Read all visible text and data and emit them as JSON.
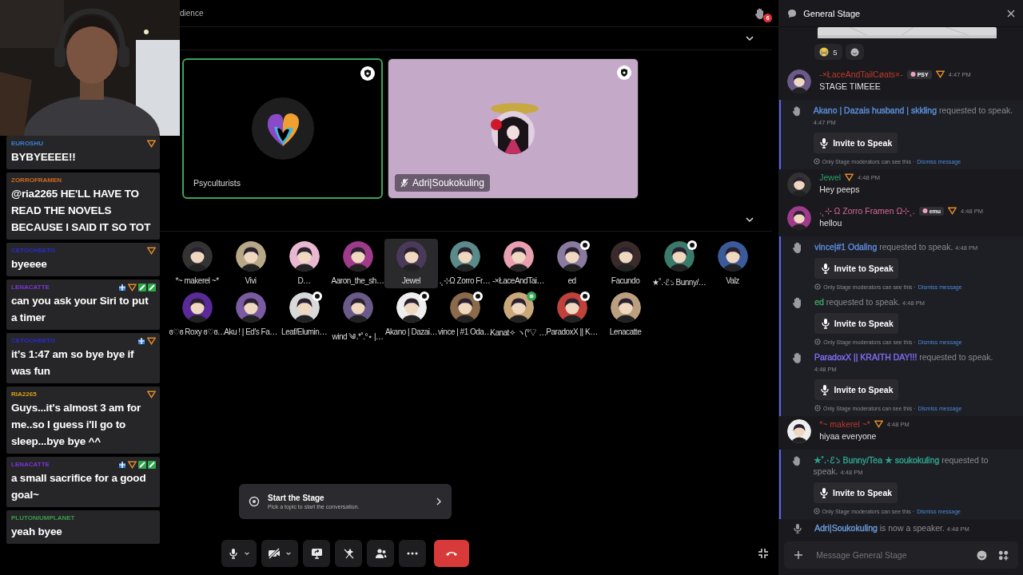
{
  "stage": {
    "topic": "dience",
    "raised_hands": "6",
    "speakers": [
      {
        "name": "Psyculturists",
        "speaking": true,
        "muted": false,
        "color": "#000000",
        "kind": "logo"
      },
      {
        "name": "Adri|Soukokuling",
        "speaking": false,
        "muted": true,
        "color": "#c4aac8",
        "kind": "picture"
      }
    ],
    "audience": [
      {
        "name": "*~ makerel ~*",
        "selected": false
      },
      {
        "name": "Vivi",
        "selected": false
      },
      {
        "name": "D…",
        "selected": false
      },
      {
        "name": "Aaron_the_sh…",
        "selected": false
      },
      {
        "name": "Jewel",
        "selected": true
      },
      {
        "name": ".˛⊹Ω Zorro Fr…",
        "selected": false
      },
      {
        "name": "-×ŁaceAndTai…",
        "selected": false
      },
      {
        "name": "ed",
        "selected": false,
        "badge": {
          "kind": "moderator"
        }
      },
      {
        "name": "Facundo",
        "selected": false
      },
      {
        "name": "★˚.·ℰ১ Bunny/…",
        "selected": false,
        "badge": {
          "kind": "moderator"
        }
      },
      {
        "name": "Valz",
        "selected": false
      },
      {
        "name": "ɞ♡ɞ Roxy ɞ♡ɞ…",
        "selected": false
      },
      {
        "name": "Aku ! | Ed's Fa…",
        "selected": false
      },
      {
        "name": "Leaf/Elumin…",
        "selected": false,
        "badge": {
          "kind": "moderator"
        }
      },
      {
        "name": "wind ༄.*˚.°⋆ |…",
        "selected": false
      },
      {
        "name": "Akano | Dazai…",
        "selected": false,
        "badge": {
          "kind": "moderator"
        }
      },
      {
        "name": "vince | #1 Oda…",
        "selected": false,
        "badge": {
          "kind": "moderator"
        }
      },
      {
        "name": "Kanat✧ ヽ(°▽ …",
        "selected": false,
        "badge": {
          "kind": "boost"
        }
      },
      {
        "name": "ParadoxX || K…",
        "selected": false,
        "badge": {
          "kind": "moderator"
        }
      },
      {
        "name": "Lenacatte",
        "selected": false
      }
    ],
    "start_card": {
      "title": "Start the Stage",
      "subtitle": "Pick a topic to start the conversation."
    },
    "controls": [
      {
        "kind": "mic",
        "caret": true
      },
      {
        "kind": "camera-off",
        "caret": true
      },
      {
        "kind": "share"
      },
      {
        "kind": "effects-off"
      },
      {
        "kind": "people"
      },
      {
        "kind": "more"
      },
      {
        "kind": "leave"
      }
    ]
  },
  "chat_overlay": [
    {
      "user": "EUROSHU",
      "color": "#3b7fd4",
      "badges": [
        {
          "kind": "triangle"
        }
      ],
      "text": "BYBYEEEE!!"
    },
    {
      "user": "ZORROFRAMEN",
      "color": "#d2691e",
      "text": "@ria2265 HE'LL HAVE TO READ THE NOVELS BECAUSE I SAID IT SO TOT"
    },
    {
      "user": "CETOCHEETO",
      "color": "#2a2ad0",
      "badges": [
        {
          "kind": "triangle"
        }
      ],
      "text": "byeeee"
    },
    {
      "user": "LENACATTE",
      "color": "#7a35d6",
      "badges": [
        {
          "kind": "gift"
        },
        {
          "kind": "triangle"
        },
        {
          "kind": "sword"
        },
        {
          "kind": "sword"
        }
      ],
      "text": "can you ask your Siri to put a timer"
    },
    {
      "user": "CETOCHEETO",
      "color": "#2a2ad0",
      "badges": [
        {
          "kind": "gift"
        },
        {
          "kind": "triangle"
        }
      ],
      "text": "it’s 1:47 am so bye bye if was fun"
    },
    {
      "user": "RIA2265",
      "color": "#d4a017",
      "badges": [
        {
          "kind": "triangle"
        }
      ],
      "text": "Guys...it's almost 3 am for me..so I guess i'll go to sleep...bye bye ^^"
    },
    {
      "user": "LENACATTE",
      "color": "#7a35d6",
      "badges": [
        {
          "kind": "gift"
        },
        {
          "kind": "triangle"
        },
        {
          "kind": "sword"
        },
        {
          "kind": "sword"
        }
      ],
      "text": "a small sacrifice for a good goal~"
    },
    {
      "user": "PLUTONIUMPLANET",
      "color": "#3a9a4a",
      "text": "yeah byee"
    }
  ],
  "panel": {
    "title": "General Stage",
    "reaction_count": "5",
    "messages": [
      {
        "kind": "message",
        "name": "-×ŁaceAndTailCøats×-",
        "color": "#c0392b",
        "tag": "PSY",
        "time": "4:47 PM",
        "text": "STAGE TIMEEE"
      },
      {
        "kind": "request",
        "name": "Akano | Dazais husband | skkling",
        "color": "#5b8fd6",
        "text": "requested to speak.",
        "time": "4:47 PM",
        "button": "Invite to Speak",
        "note": "Only Stage moderators can see this ·",
        "link": "Dismiss message"
      },
      {
        "kind": "message",
        "name": "Jewel",
        "color": "#2e9d6a",
        "time": "4:48 PM",
        "text": "Hey peeps"
      },
      {
        "kind": "message",
        "name": ".˛⊹ Ω Zorro Framen Ω⊹˛.",
        "color": "#d86a9a",
        "tag": "emu",
        "time": "4:48 PM",
        "text": "hellou"
      },
      {
        "kind": "request",
        "name": "vince|#1 Odaling",
        "color": "#5b8ad8",
        "text": "requested to speak.",
        "time": "4:48 PM",
        "button": "Invite to Speak",
        "note": "Only Stage moderators can see this ·",
        "link": "Dismiss message"
      },
      {
        "kind": "request",
        "name": "ed",
        "color": "#3ba55c",
        "text": "requested to speak.",
        "time": "4:48 PM",
        "button": "Invite to Speak",
        "note": "Only Stage moderators can see this ·",
        "link": "Dismiss message"
      },
      {
        "kind": "request",
        "name": "ParadoxX || KRAITH DAY!!!",
        "color": "#7b6ff0",
        "text": "requested to speak.",
        "time": "4:48 PM",
        "button": "Invite to Speak",
        "note": "Only Stage moderators can see this ·",
        "link": "Dismiss message"
      },
      {
        "kind": "message",
        "name": "*~ makerel ~*",
        "color": "#c0392b",
        "time": "4:48 PM",
        "text": "hiyaa everyone"
      },
      {
        "kind": "request",
        "name": "★˚.·ℰ১ Bunny/Tea ★ soukokuling",
        "color": "#2fa38a",
        "text": "requested to speak.",
        "time": "4:48 PM",
        "button": "Invite to Speak",
        "note": "Only Stage moderators can see this ·",
        "link": "Dismiss message"
      },
      {
        "kind": "speaker",
        "name": "Adri|Soukokuling",
        "color": "#6a9ad8",
        "text": "is now a speaker.",
        "time": "4:48 PM"
      }
    ],
    "composer": {
      "placeholder": "Message General Stage"
    }
  }
}
